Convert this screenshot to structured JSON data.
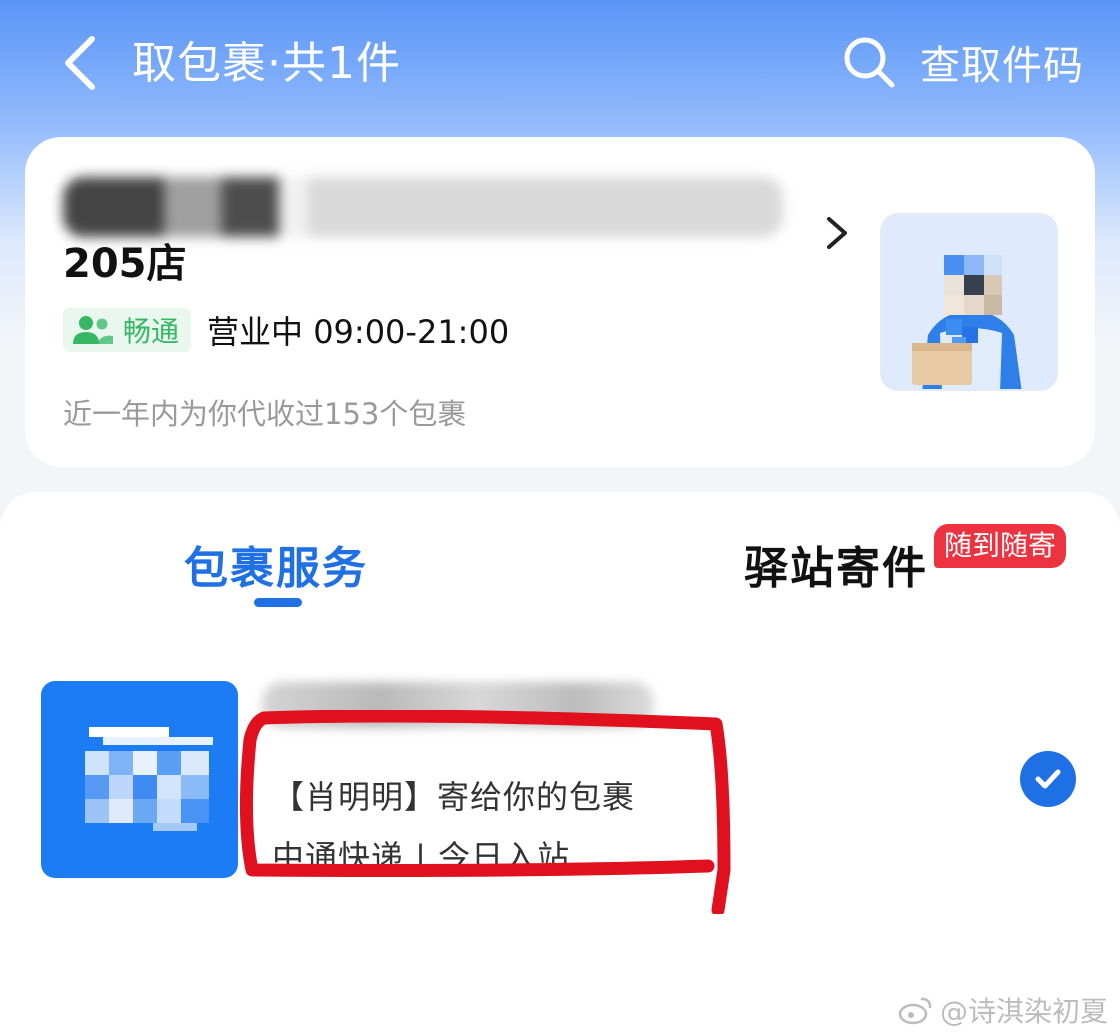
{
  "colors": {
    "header_blue": "#5a95f7",
    "accent_blue": "#1f6fe5",
    "status_green": "#34b864",
    "badge_red": "#ee3340",
    "annotation_red": "#e0101e"
  },
  "header": {
    "title": "取包裹·共1件",
    "search_label": "查取件码",
    "back_icon": "chevron-left-icon",
    "search_icon": "search-icon"
  },
  "station": {
    "name_line2": "205店",
    "badge_label": "畅通",
    "badge_icon": "users-icon",
    "status": "营业中 09:00-21:00",
    "note": "近一年内为你代收过153个包裹",
    "detail_icon": "chevron-right-icon"
  },
  "tabs": {
    "parcel_service": "包裹服务",
    "station_send": "驿站寄件",
    "send_badge": "随到随寄"
  },
  "parcel": {
    "sender_line": "【肖明明】寄给你的包裹",
    "courier_line": "中通快递 | 今日入站",
    "selected": true,
    "check_icon": "check-circle-icon"
  },
  "watermark": {
    "text": "@诗淇染初夏",
    "icon": "weibo-icon"
  }
}
